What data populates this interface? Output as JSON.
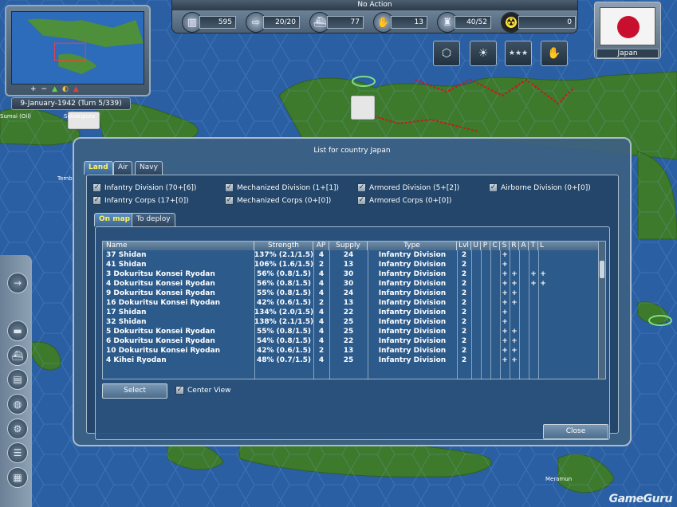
{
  "top_bar": {
    "action": "No Action",
    "resources": [
      {
        "icon": "factory-icon",
        "value": "595"
      },
      {
        "icon": "arrow-icon",
        "value": "20/20"
      },
      {
        "icon": "ship-icon",
        "value": "77"
      },
      {
        "icon": "handshake-icon",
        "value": "13"
      },
      {
        "icon": "soldier-icon",
        "value": "40/52"
      },
      {
        "icon": "nuclear-icon",
        "value": "0"
      }
    ]
  },
  "country": {
    "name": "Japan",
    "flag_color": "#c8102e"
  },
  "minimap": {
    "date_turn": "9-January-1942 (Turn 5/339)"
  },
  "map_labels": [
    "Sumai (Oil)",
    "Sukakipura",
    "Tembi",
    "Meramun"
  ],
  "dialog": {
    "title": "List for country Japan",
    "tabs": [
      "Land",
      "Air",
      "Navy"
    ],
    "active_tab": "Land",
    "filters": [
      {
        "label": "Infantry Division (70+[6])",
        "checked": true
      },
      {
        "label": "Mechanized Division (1+[1])",
        "checked": true
      },
      {
        "label": "Armored Division (5+[2])",
        "checked": true
      },
      {
        "label": "Airborne Division (0+[0])",
        "checked": true
      },
      {
        "label": "Infantry Corps (17+[0])",
        "checked": true
      },
      {
        "label": "Mechanized Corps (0+[0])",
        "checked": true
      },
      {
        "label": "Armored Corps (0+[0])",
        "checked": true
      }
    ],
    "subtabs": [
      "On map",
      "To deploy"
    ],
    "active_subtab": "On map",
    "table": {
      "headers": [
        "Name",
        "Strength",
        "AP",
        "Supply",
        "Type",
        "Lvl",
        "U",
        "P",
        "C",
        "S",
        "R",
        "A",
        "T",
        "L"
      ],
      "rows": [
        {
          "name": "37 Shidan",
          "strength": "137% (2.1/1.5)",
          "ap": "4",
          "supply": "24",
          "type": "Infantry Division",
          "lvl": "2",
          "s": "+",
          "r": "",
          "a": "",
          "t": ""
        },
        {
          "name": "41 Shidan",
          "strength": "106% (1.6/1.5)",
          "ap": "2",
          "supply": "13",
          "type": "Infantry Division",
          "lvl": "2",
          "s": "+",
          "r": "",
          "a": "",
          "t": ""
        },
        {
          "name": "3 Dokuritsu Konsei Ryodan",
          "strength": "56% (0.8/1.5)",
          "ap": "4",
          "supply": "30",
          "type": "Infantry Division",
          "lvl": "2",
          "s": "+",
          "r": "+",
          "a": "+",
          "t": "+"
        },
        {
          "name": "4 Dokuritsu Konsei Ryodan",
          "strength": "56% (0.8/1.5)",
          "ap": "4",
          "supply": "30",
          "type": "Infantry Division",
          "lvl": "2",
          "s": "+",
          "r": "+",
          "a": "+",
          "t": "+"
        },
        {
          "name": "9 Dokuritsu Konsei Ryodan",
          "strength": "55% (0.8/1.5)",
          "ap": "4",
          "supply": "24",
          "type": "Infantry Division",
          "lvl": "2",
          "s": "+",
          "r": "+",
          "a": "",
          "t": ""
        },
        {
          "name": "16 Dokuritsu Konsei Ryodan",
          "strength": "42% (0.6/1.5)",
          "ap": "2",
          "supply": "13",
          "type": "Infantry Division",
          "lvl": "2",
          "s": "+",
          "r": "+",
          "a": "",
          "t": ""
        },
        {
          "name": "17 Shidan",
          "strength": "134% (2.0/1.5)",
          "ap": "4",
          "supply": "22",
          "type": "Infantry Division",
          "lvl": "2",
          "s": "+",
          "r": "",
          "a": "",
          "t": ""
        },
        {
          "name": "32 Shidan",
          "strength": "138% (2.1/1.5)",
          "ap": "4",
          "supply": "25",
          "type": "Infantry Division",
          "lvl": "2",
          "s": "+",
          "r": "",
          "a": "",
          "t": ""
        },
        {
          "name": "5 Dokuritsu Konsei Ryodan",
          "strength": "55% (0.8/1.5)",
          "ap": "4",
          "supply": "25",
          "type": "Infantry Division",
          "lvl": "2",
          "s": "+",
          "r": "+",
          "a": "",
          "t": ""
        },
        {
          "name": "6 Dokuritsu Konsei Ryodan",
          "strength": "54% (0.8/1.5)",
          "ap": "4",
          "supply": "22",
          "type": "Infantry Division",
          "lvl": "2",
          "s": "+",
          "r": "+",
          "a": "",
          "t": ""
        },
        {
          "name": "10 Dokuritsu Konsei Ryodan",
          "strength": "42% (0.6/1.5)",
          "ap": "2",
          "supply": "13",
          "type": "Infantry Division",
          "lvl": "2",
          "s": "+",
          "r": "+",
          "a": "",
          "t": ""
        },
        {
          "name": "4 Kihei Ryodan",
          "strength": "48% (0.7/1.5)",
          "ap": "4",
          "supply": "25",
          "type": "Infantry Division",
          "lvl": "2",
          "s": "+",
          "r": "+",
          "a": "",
          "t": ""
        }
      ]
    },
    "select_label": "Select",
    "center_view_label": "Center View",
    "center_view_checked": true,
    "close_label": "Close"
  },
  "watermark": "GameGuru",
  "colors": {
    "ocean": "#2a5fa3",
    "land": "#3f7a2a",
    "accent_tab": "#fff35c",
    "border_line": "#c81a1a"
  }
}
